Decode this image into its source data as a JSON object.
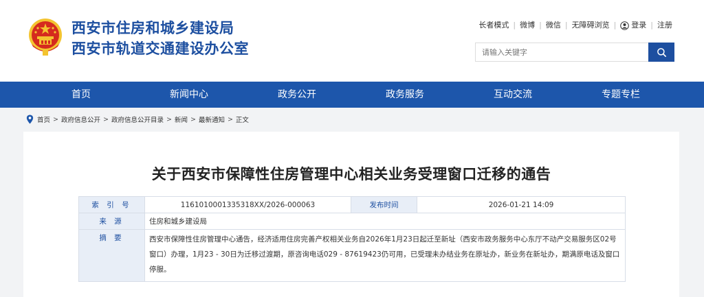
{
  "header": {
    "title_line1": "西安市住房和城乡建设局",
    "title_line2": "西安市轨道交通建设办公室",
    "top_links": {
      "elder_mode": "长者模式",
      "weibo": "微博",
      "wechat": "微信",
      "accessible": "无障碍浏览",
      "login": "登录",
      "register": "注册"
    },
    "search": {
      "placeholder": "请输入关键字"
    }
  },
  "nav": [
    "首页",
    "新闻中心",
    "政务公开",
    "政务服务",
    "互动交流",
    "专题专栏"
  ],
  "breadcrumb": [
    "首页",
    "政府信息公开",
    "政府信息公开目录",
    "新闻",
    "最新通知",
    "正文"
  ],
  "article": {
    "title": "关于西安市保障性住房管理中心相关业务受理窗口迁移的通告",
    "meta": {
      "index_label": "索 引 号",
      "index_value": "1161010001335318XX/2026-000063",
      "date_label": "发布时间",
      "date_value": "2026-01-21 14:09",
      "source_label": "来 源",
      "source_value": "住房和城乡建设局",
      "abstract_label": "摘 要",
      "abstract_value": "西安市保障性住房管理中心通告，经济适用住房完善产权相关业务自2026年1月23日起迁至新址（西安市政务服务中心东厅不动产交易服务区02号窗口）办理，1月23 - 30日为迁移过渡期，原咨询电话029 - 87619423仍可用，已受理未办结业务在原址办，新业务在新址办，期满原电话及窗口停服。"
    }
  },
  "colors": {
    "brand_blue": "#1d4fa0",
    "nav_blue": "#1d56ab",
    "emblem_red": "#d52b1e",
    "emblem_gold": "#f4c430"
  },
  "icons": [
    "national-emblem-icon",
    "user-icon",
    "search-icon",
    "location-pin-icon"
  ]
}
